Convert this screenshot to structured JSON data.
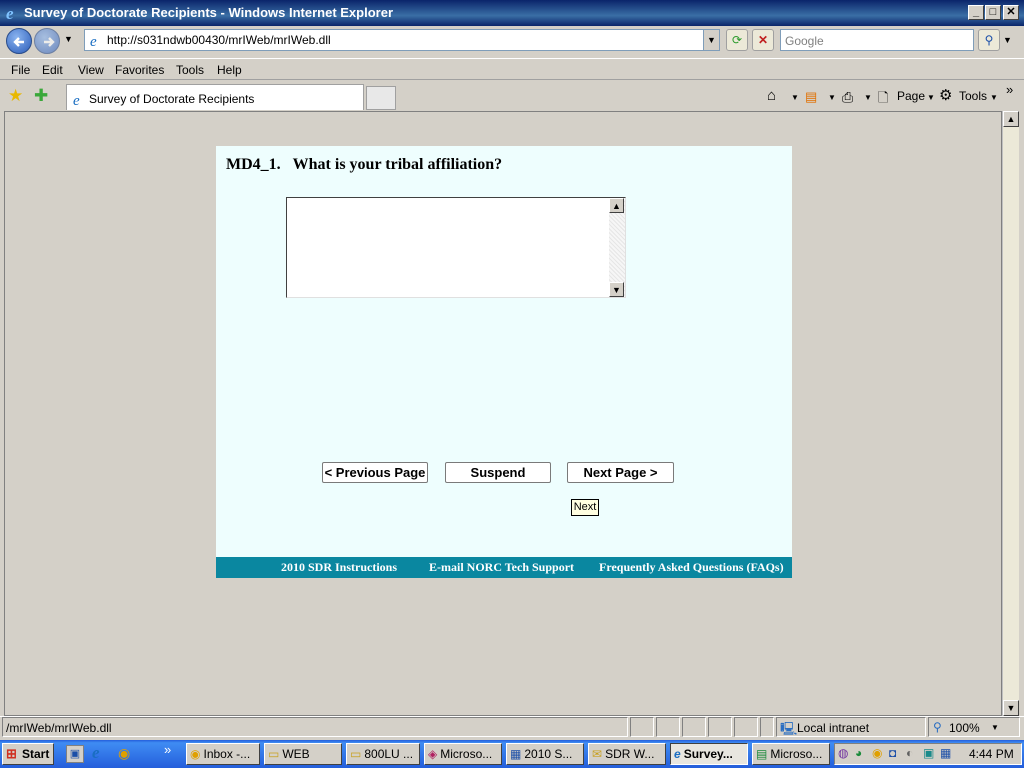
{
  "window": {
    "title": "Survey of Doctorate Recipients - Windows Internet Explorer"
  },
  "address": {
    "url": "http://s031ndwb00430/mrIWeb/mrIWeb.dll",
    "search_placeholder": "Google"
  },
  "menu": [
    "File",
    "Edit",
    "View",
    "Favorites",
    "Tools",
    "Help"
  ],
  "tab": {
    "label": "Survey of Doctorate Recipients"
  },
  "commands": {
    "page": "Page",
    "tools": "Tools"
  },
  "survey": {
    "question_id": "MD4_1.",
    "question_text": "What is your tribal affiliation?",
    "answer_value": "",
    "buttons": {
      "previous": "< Previous Page",
      "suspend": "Suspend",
      "next": "Next Page >"
    },
    "tooltip": "Next",
    "footer_links": [
      "2010 SDR Instructions",
      "E-mail NORC Tech Support",
      "Frequently Asked Questions (FAQs)"
    ],
    "colors": {
      "panel": "#eefefe",
      "footer": "#0a87a0"
    }
  },
  "status": {
    "url": "/mrIWeb/mrIWeb.dll",
    "zone": "Local intranet",
    "zoom": "100%"
  },
  "taskbar": {
    "start": "Start",
    "tasks": [
      "Inbox -...",
      "WEB",
      "800LU ...",
      "Microso...",
      "2010 S...",
      "SDR W...",
      "Survey...",
      "Microso..."
    ],
    "active_index": 6,
    "clock": "4:44 PM"
  }
}
